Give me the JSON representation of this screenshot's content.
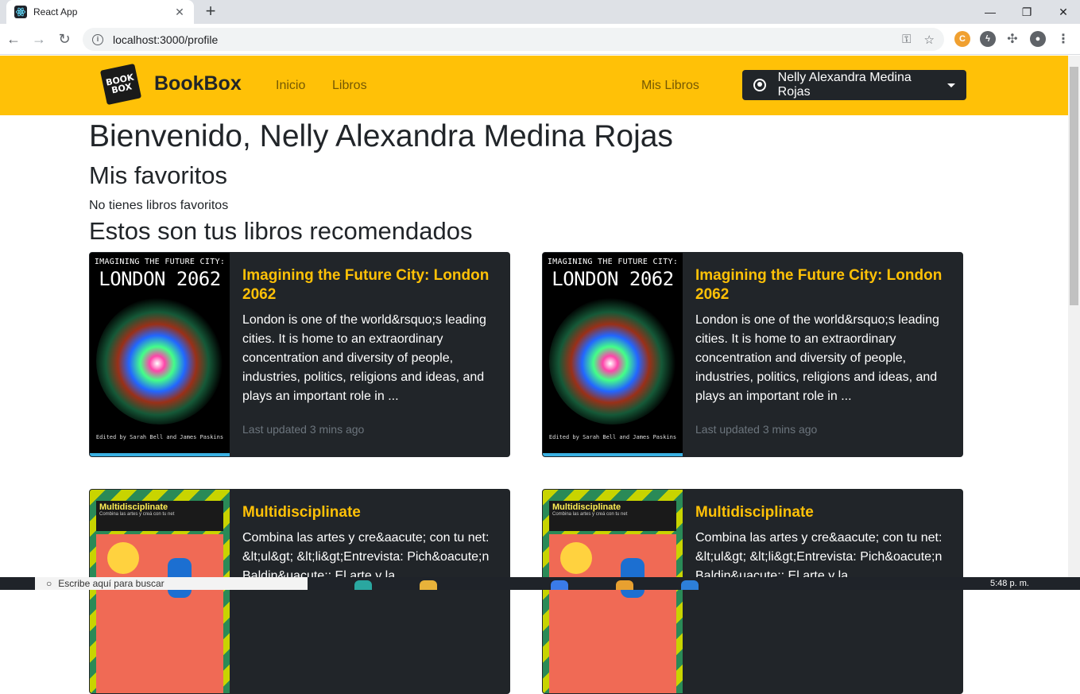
{
  "browser": {
    "tab_title": "React App",
    "url": "localhost:3000/profile"
  },
  "navbar": {
    "logo_text_1": "BOOK",
    "logo_text_2": "BOX",
    "brand": "BookBox",
    "links": [
      "Inicio",
      "Libros"
    ],
    "my_books": "Mis Libros",
    "user_name": "Nelly Alexandra Medina Rojas"
  },
  "page": {
    "welcome": "Bienvenido, Nelly Alexandra Medina Rojas",
    "favorites_heading": "Mis favoritos",
    "favorites_empty": "No tienes libros favoritos",
    "recommended_heading": "Estos son tus libros recomendados"
  },
  "books": [
    {
      "title": "Imagining the Future City: London 2062",
      "description": "London is one of the world&rsquo;s leading cities. It is home to an extraordinary concentration and diversity of people, industries, politics, religions and ideas, and plays an important role in ...",
      "updated": "Last updated 3 mins ago",
      "cover_line1": "IMAGINING THE FUTURE CITY:",
      "cover_line2": "LONDON 2062",
      "cover_credit": "Edited by Sarah Bell and James Paskins"
    },
    {
      "title": "Imagining the Future City: London 2062",
      "description": "London is one of the world&rsquo;s leading cities. It is home to an extraordinary concentration and diversity of people, industries, politics, religions and ideas, and plays an important role in ...",
      "updated": "Last updated 3 mins ago",
      "cover_line1": "IMAGINING THE FUTURE CITY:",
      "cover_line2": "LONDON 2062",
      "cover_credit": "Edited by Sarah Bell and James Paskins"
    },
    {
      "title": "Multidisciplinate",
      "description": "Combina las artes y cre&aacute; con tu net: &lt;ul&gt; &lt;li&gt;Entrevista: Pich&oacute;n Baldin&uacute;: El arte y la ...",
      "cover_title": "Multidisciplinate",
      "cover_sub": "Combina las artes y creá con tu net"
    },
    {
      "title": "Multidisciplinate",
      "description": "Combina las artes y cre&aacute; con tu net: &lt;ul&gt; &lt;li&gt;Entrevista: Pich&oacute;n Baldin&uacute;: El arte y la ...",
      "cover_title": "Multidisciplinate",
      "cover_sub": "Combina las artes y creá con tu net"
    }
  ],
  "taskbar": {
    "search_placeholder": "Escribe aquí para buscar",
    "clock": "5:48 p. m."
  },
  "colors": {
    "navbar_bg": "#ffc107",
    "card_bg": "#212529",
    "title_accent": "#ffc107"
  }
}
